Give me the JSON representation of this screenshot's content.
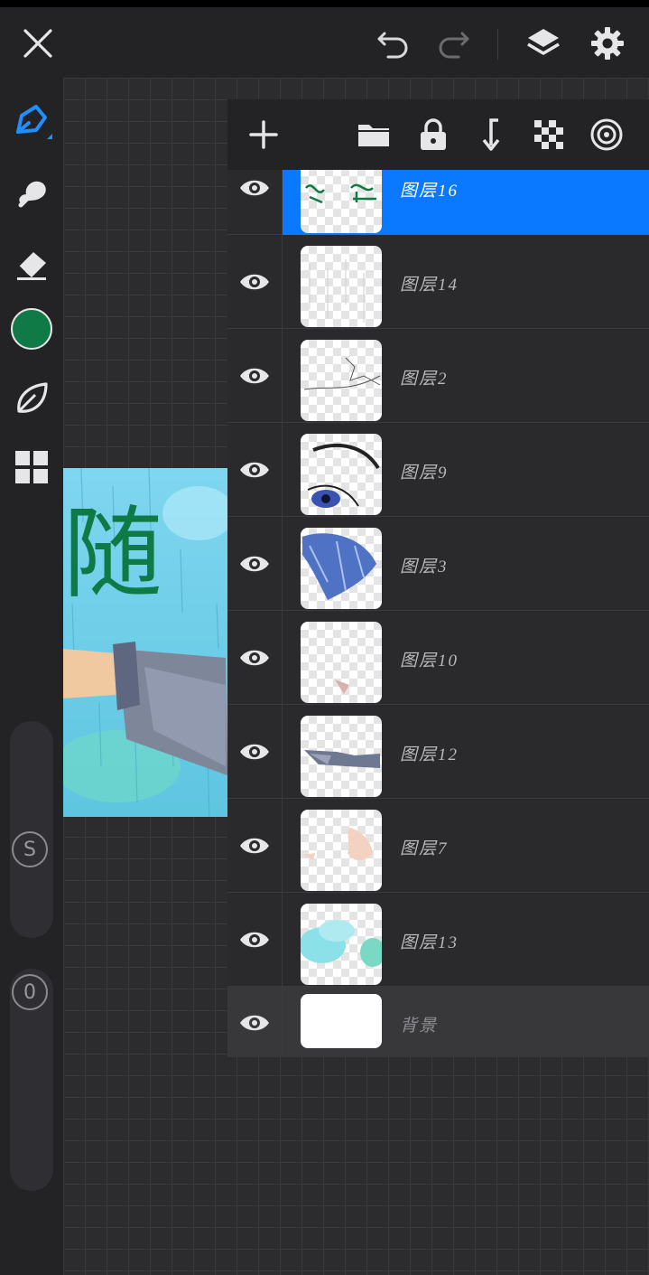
{
  "colors": {
    "accent": "#0a78ff",
    "current_color": "#0f7a45"
  },
  "topbar": {
    "icons": [
      "close-icon",
      "undo-icon",
      "redo-icon",
      "layers-icon",
      "settings-icon"
    ]
  },
  "tools": {
    "icons": [
      "brush-icon",
      "smudge-icon",
      "eraser-icon",
      "color-swatch",
      "leaf-icon",
      "grid-icon"
    ],
    "size_slider_label": "S",
    "opacity_slider_label": "0"
  },
  "layers_panel": {
    "actions": [
      "add-layer-icon",
      "folder-icon",
      "lock-icon",
      "merge-down-icon",
      "transparency-icon",
      "radial-icon"
    ],
    "layers": [
      {
        "name": "图层16",
        "selected": true
      },
      {
        "name": "图层14"
      },
      {
        "name": "图层2"
      },
      {
        "name": "图层9"
      },
      {
        "name": "图层3"
      },
      {
        "name": "图层10"
      },
      {
        "name": "图层12"
      },
      {
        "name": "图层7"
      },
      {
        "name": "图层13"
      },
      {
        "name": "背景"
      }
    ]
  },
  "artwork": {
    "text": "随"
  }
}
